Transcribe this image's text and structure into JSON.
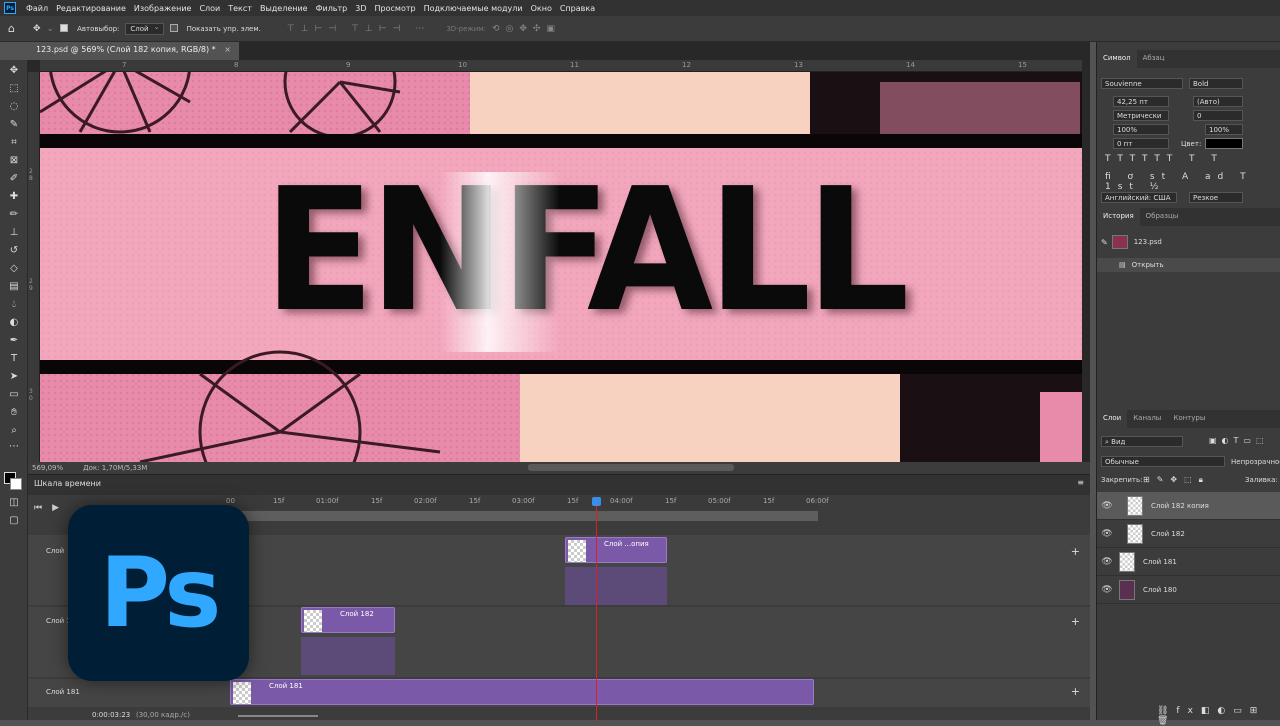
{
  "menu": [
    "Файл",
    "Редактирование",
    "Изображение",
    "Слои",
    "Текст",
    "Выделение",
    "Фильтр",
    "3D",
    "Просмотр",
    "Подключаемые модули",
    "Окно",
    "Справка"
  ],
  "ps_mini": "Ps",
  "options": {
    "autoselect_label": "Автовыбор:",
    "autoselect_value": "Слой",
    "show_controls": "Показать упр. элем.",
    "mode3d": "3D-режим:"
  },
  "document_tab": "123.psd @ 569% (Слой 182 копия, RGB/8) *",
  "ruler_top": [
    "7",
    "8",
    "9",
    "10",
    "11",
    "12",
    "13",
    "14",
    "15"
  ],
  "ruler_left": [
    "2 8",
    "2 9",
    "3 0"
  ],
  "artwork_text": "ENFALL",
  "status": {
    "zoom": "569,09%",
    "doc": "Док: 1,70M/5,33M"
  },
  "timeline": {
    "title": "Шкала времени",
    "ticks": [
      "00",
      "15f",
      "01:00f",
      "15f",
      "02:00f",
      "15f",
      "03:00f",
      "15f",
      "04:00f",
      "15f",
      "05:00f",
      "15f",
      "06:00f"
    ],
    "track_labels": [
      "Слой",
      "Слой 1",
      "Слой 181"
    ],
    "clips": [
      "Слой ...опия",
      "Слой 182",
      "Слой 181"
    ],
    "timecode": "0:00:03:23",
    "fps": "(30,00 кадр./с)"
  },
  "character": {
    "tabs": [
      "Символ",
      "Абзац"
    ],
    "font": "Souvienne",
    "style": "Bold",
    "size": "42,25 пт",
    "leading": "(Авто)",
    "kerning": "Метрически",
    "tracking": "0",
    "vscale": "100%",
    "hscale": "100%",
    "baseline": "0 пт",
    "color_label": "Цвет:",
    "language": "Английский: США",
    "aa": "Резкое"
  },
  "history": {
    "tabs": [
      "История",
      "Образцы"
    ],
    "snapshot": "123.psd",
    "items": [
      "Открыть"
    ]
  },
  "layers": {
    "tabs": [
      "Слои",
      "Каналы",
      "Контуры"
    ],
    "filter": "Вид",
    "blend": "Обычные",
    "opacity_label": "Непрозрачность:",
    "lock_label": "Закрепить:",
    "fill_label": "Заливка:",
    "items": [
      "Слой 182 копия",
      "Слой 182",
      "Слой 181",
      "Слой 180"
    ]
  },
  "logo_text": "Ps"
}
